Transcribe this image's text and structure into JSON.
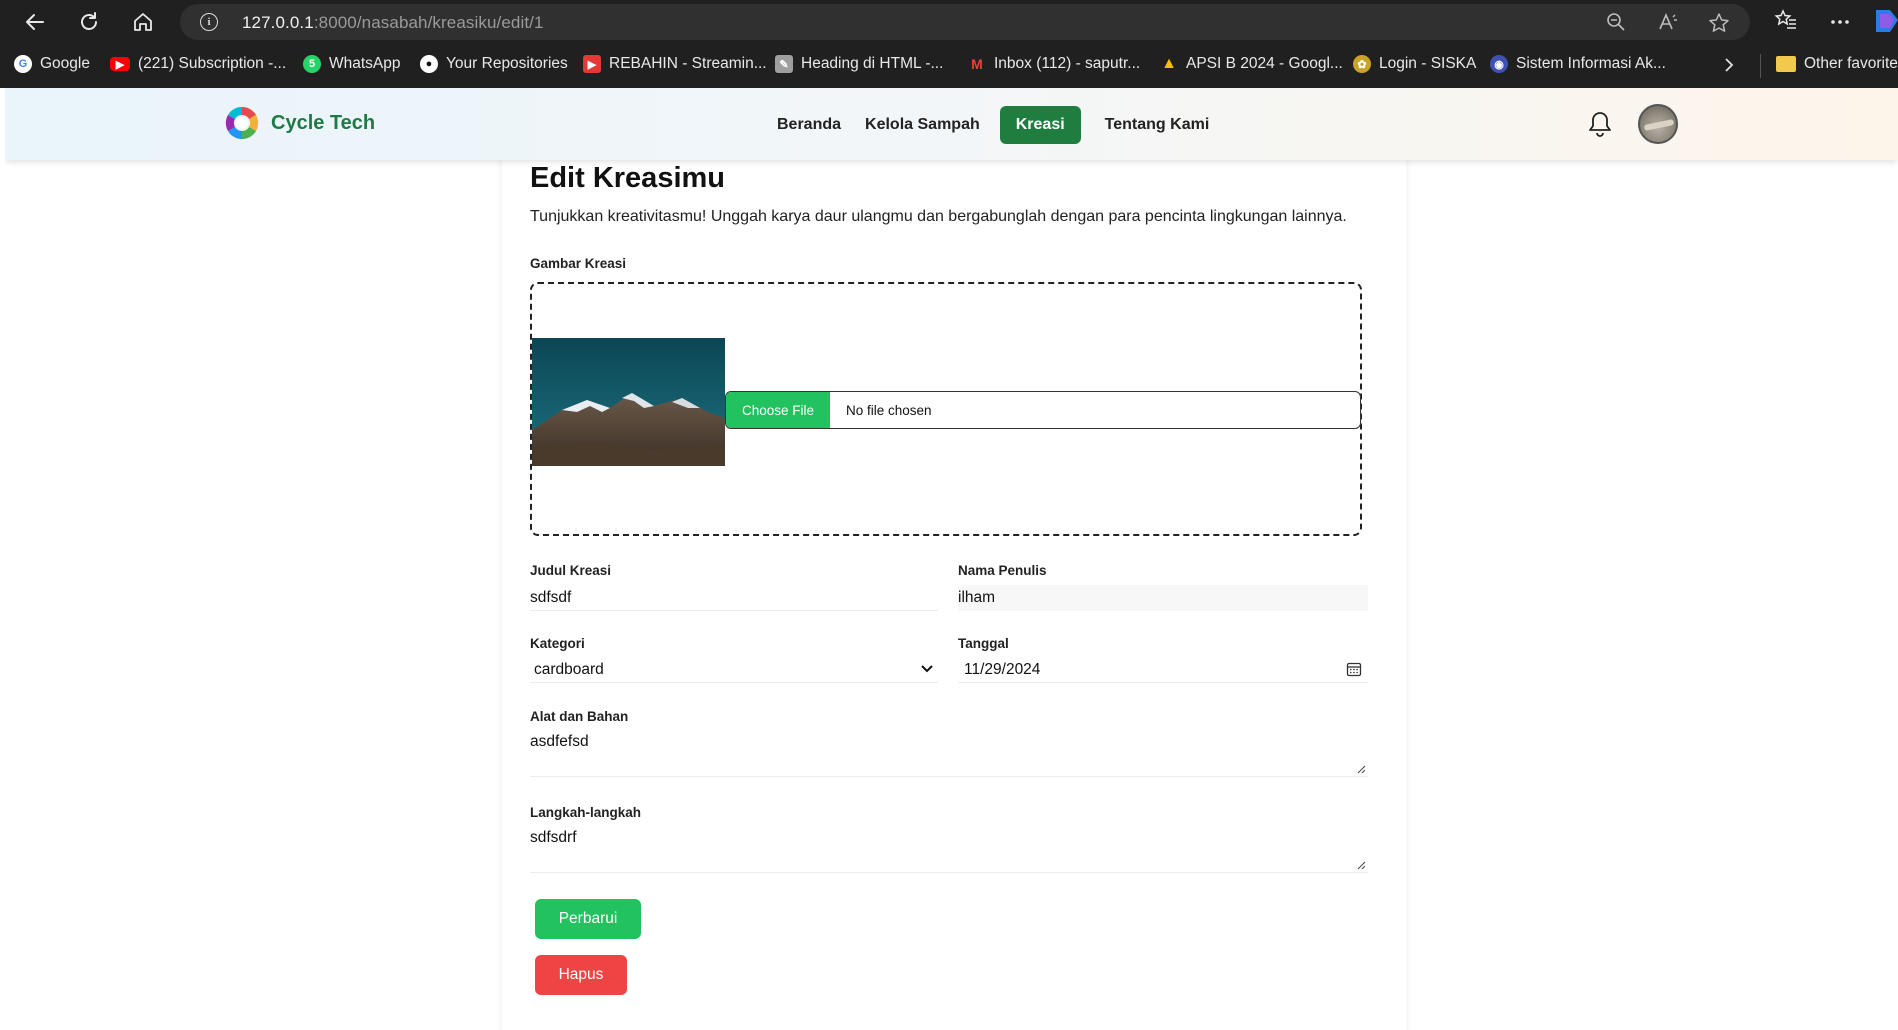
{
  "browser": {
    "url_host": "127.0.0.1",
    "url_rest": ":8000/nasabah/kreasiku/edit/1",
    "bookmarks": [
      {
        "label": "Google",
        "icon": "google-icon",
        "color": "#ffffff"
      },
      {
        "label": "(221) Subscription -...",
        "icon": "youtube-icon",
        "color": "#ff0000"
      },
      {
        "label": "WhatsApp",
        "icon": "whatsapp-icon",
        "color": "#25d366"
      },
      {
        "label": "Your Repositories",
        "icon": "github-icon",
        "color": "#ffffff"
      },
      {
        "label": "REBAHIN - Streamin...",
        "icon": "rebahin-icon",
        "color": "#e53935"
      },
      {
        "label": "Heading di HTML -...",
        "icon": "html-icon",
        "color": "#9e9e9e"
      },
      {
        "label": "Inbox (112) - saputr...",
        "icon": "gmail-icon",
        "color": "#ea4335"
      },
      {
        "label": "APSI B 2024 - Googl...",
        "icon": "drive-icon",
        "color": "#fbbc04"
      },
      {
        "label": "Login - SISKA",
        "icon": "siska-icon",
        "color": "#c9a227"
      },
      {
        "label": "Sistem Informasi Ak...",
        "icon": "siakad-icon",
        "color": "#3f51b5"
      }
    ],
    "other_favorites": "Other favorites"
  },
  "app": {
    "brand": "Cycle Tech",
    "nav": [
      {
        "label": "Beranda",
        "active": false
      },
      {
        "label": "Kelola Sampah",
        "active": false
      },
      {
        "label": "Kreasi",
        "active": true
      },
      {
        "label": "Tentang Kami",
        "active": false
      }
    ],
    "accent": "#1e7d3f"
  },
  "form": {
    "title": "Edit Kreasimu",
    "subtitle": "Tunjukkan kreativitasmu! Unggah karya daur ulangmu dan bergabunglah dengan para pencinta lingkungan lainnya.",
    "image": {
      "label": "Gambar Kreasi",
      "choose_label": "Choose File",
      "status": "No file chosen"
    },
    "judul": {
      "label": "Judul Kreasi",
      "value": "sdfsdf"
    },
    "penulis": {
      "label": "Nama Penulis",
      "value": "ilham"
    },
    "kategori": {
      "label": "Kategori",
      "value": "cardboard"
    },
    "tanggal": {
      "label": "Tanggal",
      "value": "11/29/2024"
    },
    "alat": {
      "label": "Alat dan Bahan",
      "value": "asdfefsd"
    },
    "langkah": {
      "label": "Langkah-langkah",
      "value": "sdfsdrf"
    },
    "submit_label": "Perbarui",
    "delete_label": "Hapus",
    "submit_color": "#22c35e",
    "delete_color": "#ee4444"
  }
}
